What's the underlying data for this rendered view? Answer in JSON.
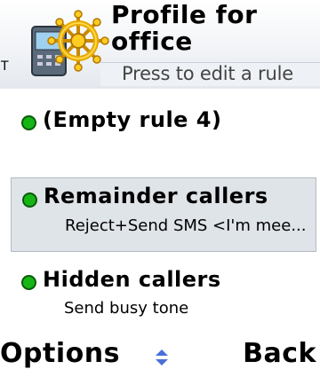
{
  "header": {
    "title": "Profile for office",
    "title_line1": "Profile for",
    "title_line2": "office",
    "hint": "Press to edit a rule",
    "signal_label": "T",
    "app_icon": "phone-with-ship-wheel-icon"
  },
  "rules": [
    {
      "title": "(Empty rule 4)",
      "subtitle": ""
    },
    {
      "title": "Remainder callers",
      "subtitle": "Reject+Send SMS <I'm mee..."
    },
    {
      "title": "Hidden callers",
      "subtitle": "Send busy tone"
    }
  ],
  "softkeys": {
    "left": "Options",
    "right": "Back",
    "center_icon": "scroll-arrows-icon"
  },
  "colors": {
    "status_dot": "#16b516",
    "selection_bg": "#dfe4e9",
    "header_bg": "#eef1f5"
  }
}
